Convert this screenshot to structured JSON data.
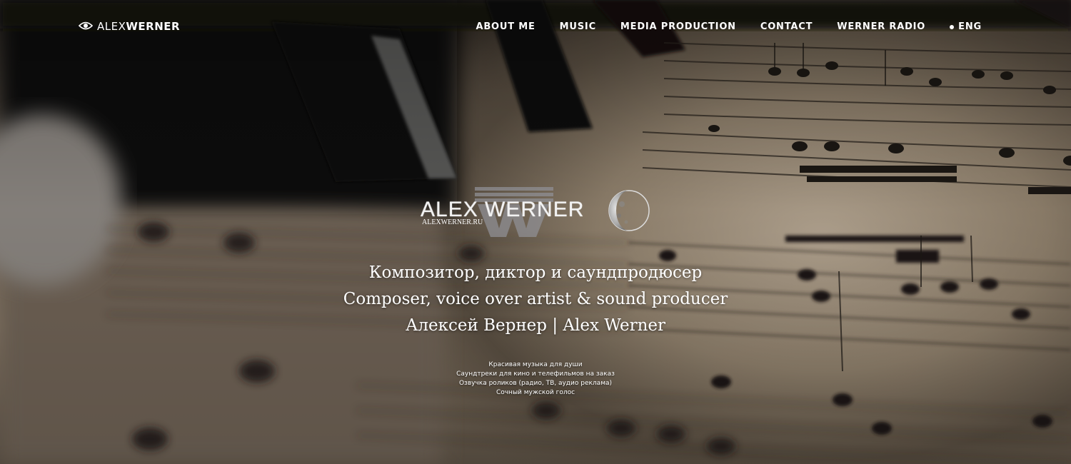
{
  "header": {
    "logo": {
      "icon": "eye-icon",
      "light_text": "ALEX",
      "bold_text": "WERNER"
    },
    "nav": [
      {
        "label": "ABOUT ME"
      },
      {
        "label": "MUSIC"
      },
      {
        "label": "MEDIA PRODUCTION"
      },
      {
        "label": "CONTACT"
      },
      {
        "label": "WERNER RADIO"
      },
      {
        "label": "ENG",
        "icon": "dot-icon"
      }
    ]
  },
  "hero": {
    "brand_name": "ALEX WERNER",
    "brand_url": "ALEXWERNER.RU",
    "lines": [
      "Композитор, диктор и саундпродюсер",
      "Composer, voice over artist & sound producer",
      "Алексей Вернер | Alex Werner"
    ],
    "sublines": [
      "Красивая музыка для души",
      "Саундтреки для кино и телефильмов на заказ",
      "Озвучка роликов (радио, ТВ, аудио реклама)",
      "Сочный мужской голос"
    ]
  },
  "colors": {
    "text": "#ffffff",
    "background_dark": "#1a1714",
    "paper": "#b5a692"
  }
}
